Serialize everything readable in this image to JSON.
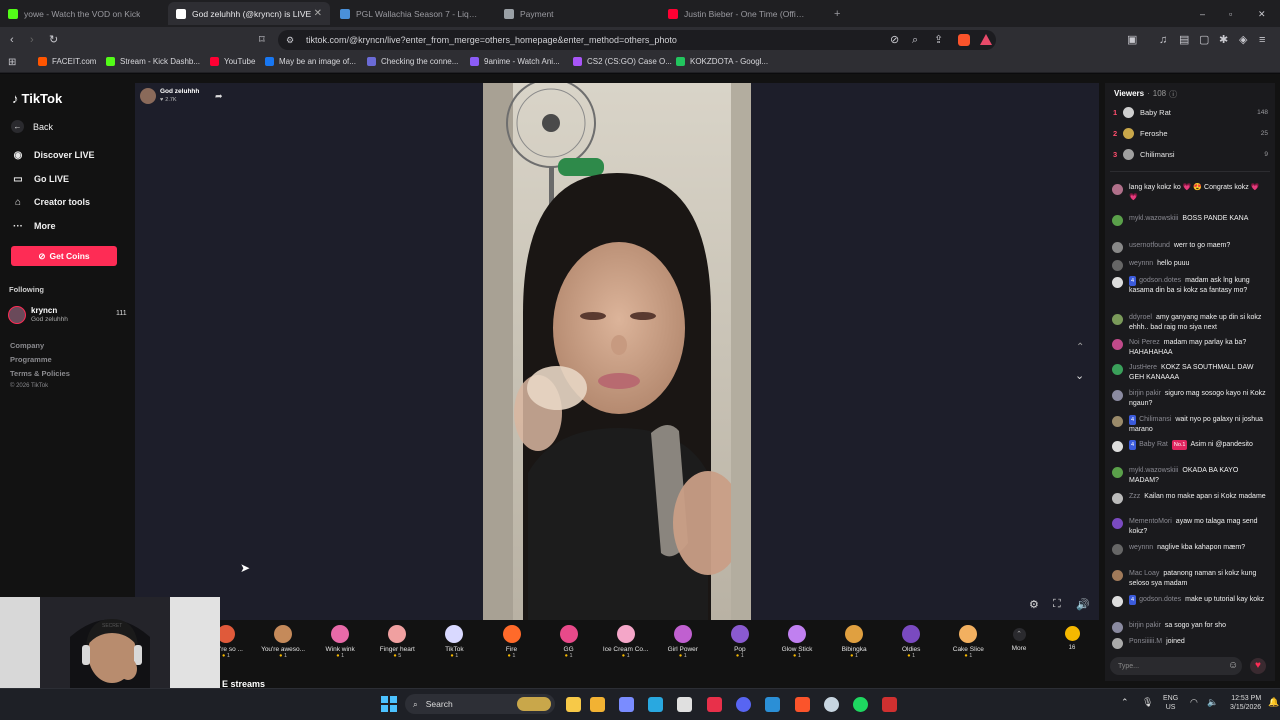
{
  "browser": {
    "tabs": [
      {
        "title": "yowe - Watch the VOD on Kick",
        "color": "#53fc18",
        "active": false
      },
      {
        "title": "God zeluhhh (@kryncn) is LIVE",
        "color": "#ffffff",
        "active": true
      },
      {
        "title": "PGL Wallachia Season 7 - Liquipedia",
        "color": "#4a90d9",
        "active": false
      },
      {
        "title": "Payment",
        "color": "#9aa0a6",
        "active": false
      },
      {
        "title": "Justin Bieber - One Time (Official Music Video)",
        "color": "#ff0033",
        "active": false
      }
    ],
    "new_tab_label": "+",
    "url": "tiktok.com/@kryncn/live?enter_from_merge=others_homepage&enter_method=others_photo",
    "bookmarks": [
      {
        "label": "FACEIT.com",
        "color": "#ff5500"
      },
      {
        "label": "Stream - Kick Dashb...",
        "color": "#53fc18"
      },
      {
        "label": "YouTube",
        "color": "#ff0033"
      },
      {
        "label": "May be an image of...",
        "color": "#1877f2"
      },
      {
        "label": "Checking the conne...",
        "color": "#6b6bd6"
      },
      {
        "label": "9anime - Watch Ani...",
        "color": "#8b5cf6"
      },
      {
        "label": "CS2 (CS:GO) Case O...",
        "color": "#a855f7"
      },
      {
        "label": "KOKZDOTA - Googl...",
        "color": "#22c55e"
      }
    ]
  },
  "sidebar": {
    "logo": "TikTok",
    "back_label": "Back",
    "nav": [
      {
        "label": "Discover LIVE",
        "icon": "live-icon"
      },
      {
        "label": "Go LIVE",
        "icon": "camera-icon"
      },
      {
        "label": "Creator tools",
        "icon": "home-icon"
      },
      {
        "label": "More",
        "icon": "more-icon"
      }
    ],
    "coins_label": "Get Coins",
    "following_label": "Following",
    "following": {
      "name": "kryncn",
      "sub": "God zeluhhh",
      "count": "111"
    },
    "footer": [
      "Company",
      "Programme",
      "Terms & Policies",
      "© 2026 TikTok"
    ]
  },
  "stream": {
    "host_name": "God zeluhhh",
    "host_likes": "2.7K",
    "gifts": [
      {
        "name": "You're so ...",
        "price": "1",
        "color": "#e05a3a"
      },
      {
        "name": "You're aweso...",
        "price": "1",
        "color": "#c58a5a"
      },
      {
        "name": "Wink wink",
        "price": "1",
        "color": "#e86aa8"
      },
      {
        "name": "Finger heart",
        "price": "5",
        "color": "#f0a0a0"
      },
      {
        "name": "TikTok",
        "price": "1",
        "color": "#d9d9ff"
      },
      {
        "name": "Fire",
        "price": "1",
        "color": "#ff6a2a"
      },
      {
        "name": "GG",
        "price": "1",
        "color": "#e84a8a"
      },
      {
        "name": "Ice Cream Co...",
        "price": "1",
        "color": "#f4a6c8"
      },
      {
        "name": "Girl Power",
        "price": "1",
        "color": "#c060d0"
      },
      {
        "name": "Pop",
        "price": "1",
        "color": "#8a5ad0"
      },
      {
        "name": "Glow Stick",
        "price": "1",
        "color": "#c080f0"
      },
      {
        "name": "Bibingka",
        "price": "1",
        "color": "#e0a040"
      },
      {
        "name": "Oldies",
        "price": "1",
        "color": "#7a4ac0"
      },
      {
        "name": "Cake Slice",
        "price": "1",
        "color": "#f2b060"
      }
    ],
    "more_label": "More",
    "coin_count": "16",
    "bottom_text": "E streams"
  },
  "viewers": {
    "title": "Viewers",
    "count": "108",
    "top": [
      {
        "rank": "1",
        "name": "Baby Rat",
        "score": "148"
      },
      {
        "rank": "2",
        "name": "Feroshe",
        "score": "25"
      },
      {
        "rank": "3",
        "name": "Chilimansi",
        "score": "9"
      }
    ]
  },
  "chat": [
    {
      "user": "",
      "text": "lang kay kokz ko 💗 😍 Congrats kokz 💗 💗",
      "color": "#b0708a"
    },
    {
      "user": "mykl.wazowskiii",
      "text": "BOSS PANDE KANA",
      "color": "#5aa04a"
    },
    {
      "user": "usernotfound",
      "text": "werr to go maem?",
      "color": "#888888"
    },
    {
      "user": "weynnn",
      "text": "hello puuu",
      "color": "#666666"
    },
    {
      "user": "godson.dotes",
      "badge": "4",
      "text": "madam ask lng kung kasama din ba si kokz sa fantasy mo?",
      "color": "#dddddd"
    },
    {
      "user": "ddyroel",
      "text": "amy ganyang make up din si kokz ehhh.. bad raig mo siya next",
      "color": "#7a9a5a"
    },
    {
      "user": "Noi Perez",
      "text": "madam may parlay ka ba? HAHAHAHAA",
      "color": "#c04a8a"
    },
    {
      "user": "JustHere",
      "text": "KOKZ SA SOUTHMALL DAW GEH KANAAAA",
      "color": "#3aa05a"
    },
    {
      "user": "birjin pakir",
      "text": "siguro mag sosogo kayo ni Kokz ngaun?",
      "color": "#8a8aa0"
    },
    {
      "user": "Chilimansi",
      "badge": "4",
      "text": "wait nyo po galaxy ni joshua marano",
      "color": "#9a8a6a"
    },
    {
      "user": "Baby Rat",
      "badge": "4",
      "badge2": "No.1",
      "text": "Asim ni @pandesito",
      "color": "#dddddd"
    },
    {
      "user": "mykl.wazowskiii",
      "text": "OKADA BA KAYO MADAM?",
      "color": "#5aa04a"
    },
    {
      "user": "Zzz",
      "text": "Kailan mo make apan si Kokz madame",
      "color": "#bbbbbb"
    },
    {
      "user": "MementoMori",
      "text": "ayaw mo talaga mag send kokz?",
      "color": "#7a4ac0"
    },
    {
      "user": "weynnn",
      "text": "naglive kba kahapon mæm?",
      "color": "#666666"
    },
    {
      "user": "Mac Loay",
      "text": "patanong naman si kokz kung seloso sya madam",
      "color": "#a07a5a"
    },
    {
      "user": "godson.dotes",
      "badge": "4",
      "text": "make up tutorial kay kokz",
      "color": "#dddddd"
    },
    {
      "user": "birjin pakir",
      "text": "sa sogo yan for sho",
      "color": "#8a8aa0"
    },
    {
      "user": "Ponsiiiiii.M",
      "text": "joined",
      "color": "#aaaaaa"
    }
  ],
  "chat_input_placeholder": "Type...",
  "taskbar": {
    "search_label": "Search",
    "lang": "ENG",
    "region": "US",
    "time": "12:53 PM",
    "date": "3/15/2026"
  }
}
